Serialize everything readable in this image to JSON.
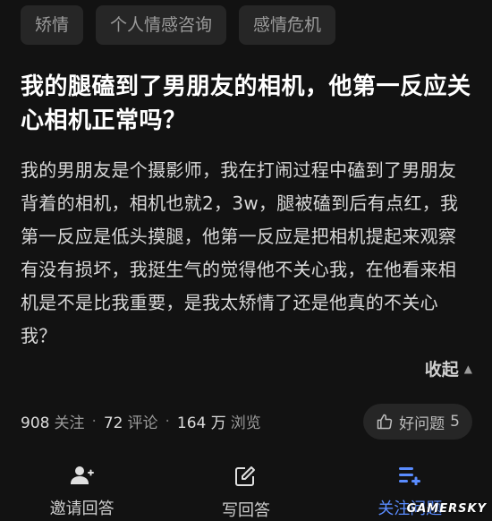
{
  "tags": [
    {
      "label": "矫情"
    },
    {
      "label": "个人情感咨询"
    },
    {
      "label": "感情危机"
    }
  ],
  "question": {
    "title": "我的腿磕到了男朋友的相机，他第一反应关心相机正常吗？",
    "body": "我的男朋友是个摄影师，我在打闹过程中磕到了男朋友背着的相机，相机也就2，3w，腿被磕到后有点红，我第一反应是低头摸腿，他第一反应是把相机提起来观察有没有损坏，我挺生气的觉得他不关心我，在他看来相机是不是比我重要，是我太矫情了还是他真的不关心我？",
    "collapse_label": "收起"
  },
  "stats": {
    "follow_count": "908",
    "follow_label": "关注",
    "comment_count": "72",
    "comment_label": "评论",
    "view_count": "164 万",
    "view_label": "浏览"
  },
  "good_question": {
    "label": "好问题",
    "count": "5"
  },
  "bottom_actions": [
    {
      "label": "邀请回答",
      "icon": "invite-user-icon"
    },
    {
      "label": "写回答",
      "icon": "edit-icon"
    },
    {
      "label": "关注问题",
      "icon": "follow-list-icon"
    }
  ],
  "watermark": "GAMERSKY",
  "colors": {
    "background": "#121212",
    "tag_bg": "#262626",
    "accent": "#5a8cff"
  }
}
